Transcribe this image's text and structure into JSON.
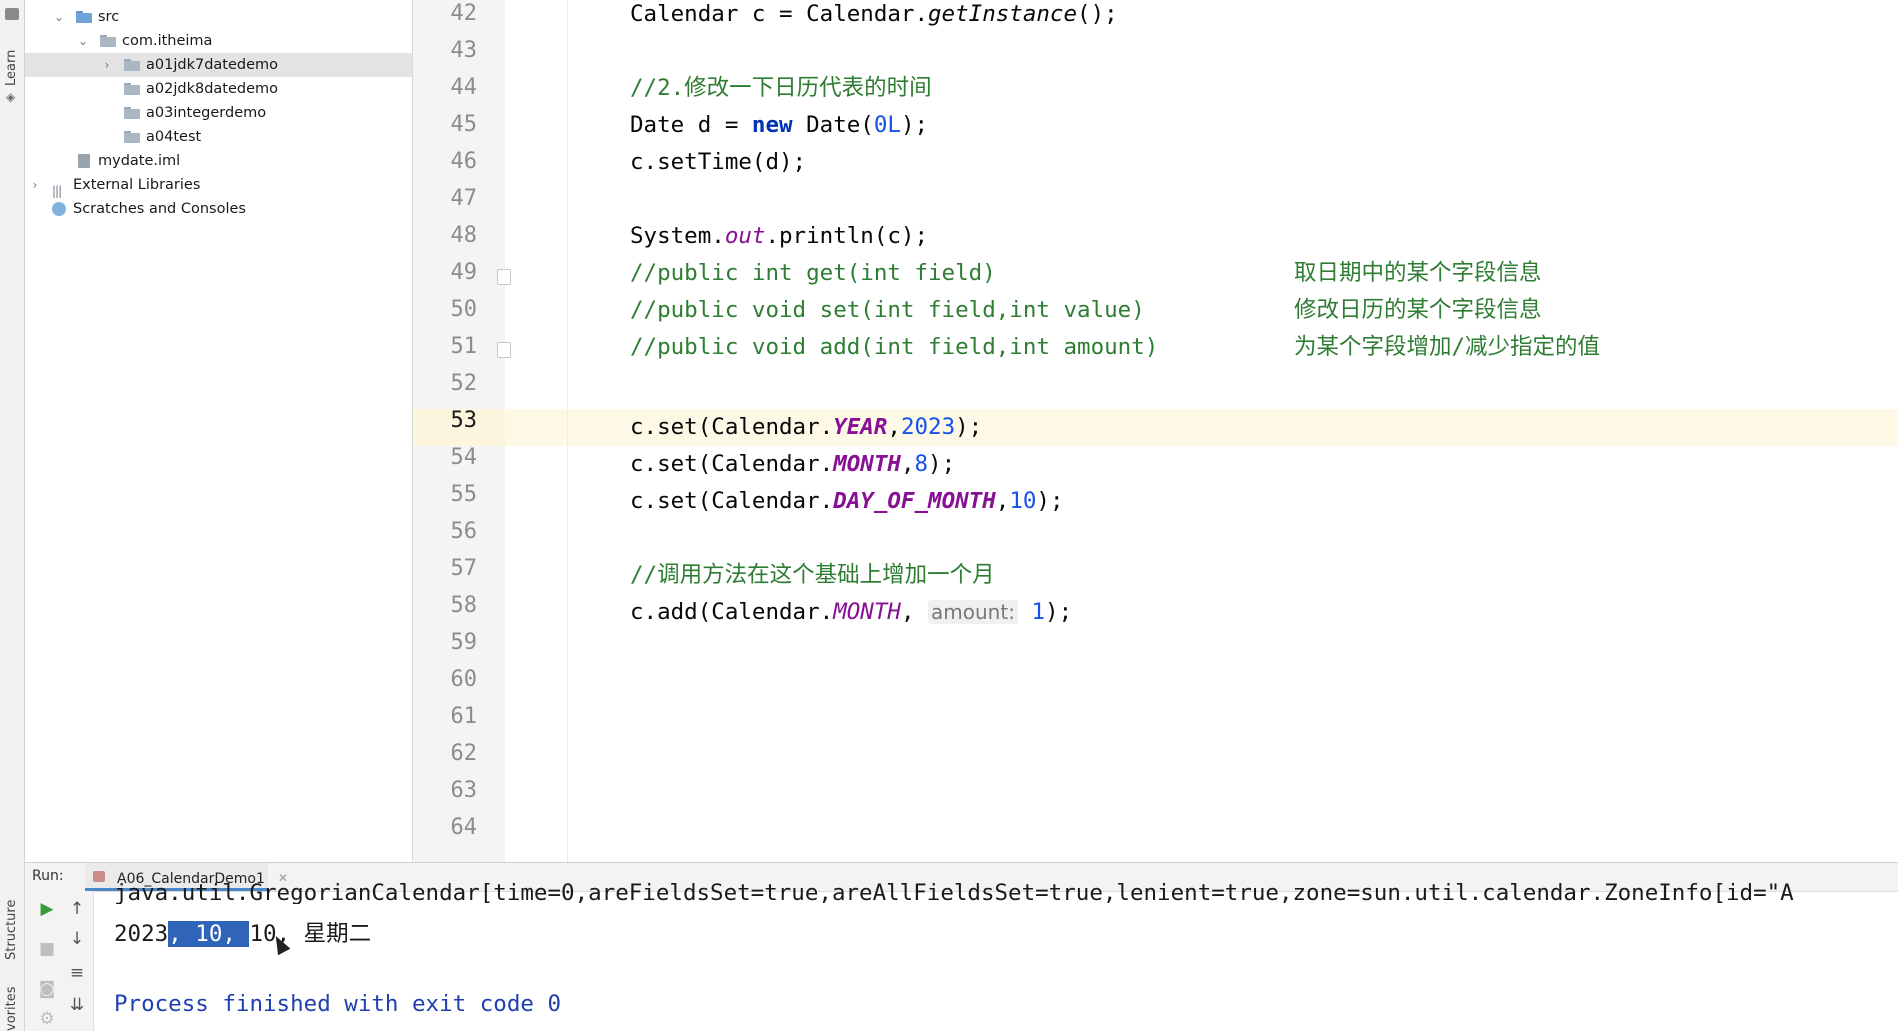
{
  "side_strip": {
    "learn_label": "Learn",
    "structure_label": "Structure",
    "favorites_label": "vorites"
  },
  "project_tree": {
    "src": "src",
    "package": "com.itheima",
    "folders": [
      "a01jdk7datedemo",
      "a02jdk8datedemo",
      "a03integerdemo",
      "a04test"
    ],
    "iml_file": "mydate.iml",
    "external_libraries": "External Libraries",
    "scratches": "Scratches and Consoles"
  },
  "editor": {
    "line_numbers": [
      "42",
      "43",
      "44",
      "45",
      "46",
      "47",
      "48",
      "49",
      "50",
      "51",
      "52",
      "53",
      "54",
      "55",
      "56",
      "57",
      "58",
      "59",
      "60",
      "61",
      "62",
      "63",
      "64"
    ],
    "current_line": "53",
    "line42": {
      "a": "Calendar c = Calendar.",
      "b": "getInstance",
      "c": "();"
    },
    "line44": "//2.修改一下日历代表的时间",
    "line45": {
      "a": "Date d = ",
      "kw": "new",
      "b": " Date(",
      "num": "0L",
      "c": ");"
    },
    "line46": "c.setTime(d);",
    "line48": {
      "a": "System.",
      "b": "out",
      "c": ".println(c);"
    },
    "line49": {
      "comment": "//public int get(int field)",
      "desc": "取日期中的某个字段信息"
    },
    "line50": {
      "comment": "//public void set(int field,int value)",
      "desc": "修改日历的某个字段信息"
    },
    "line51": {
      "comment": "//public void add(int field,int amount)",
      "desc": "为某个字段增加/减少指定的值"
    },
    "line53": {
      "a": "c.set(Calendar.",
      "f": "YEAR",
      "sep": ",",
      "num": "2023",
      "c": ");"
    },
    "line54": {
      "a": "c.set(Calendar.",
      "f": "MONTH",
      "sep": ",",
      "num": "8",
      "c": ");"
    },
    "line55": {
      "a": "c.set(Calendar.",
      "f": "DAY_OF_MONTH",
      "sep": ",",
      "num": "10",
      "c": ");"
    },
    "line57": "//调用方法在这个基础上增加一个月",
    "line58": {
      "a": "c.add(Calendar.",
      "f": "MONTH",
      "sep": ", ",
      "hint": "amount:",
      "num": "1",
      "c": ");"
    }
  },
  "run": {
    "label": "Run:",
    "tab": "A06_CalendarDemo1",
    "output_line1": "java.util.GregorianCalendar[time=0,areFieldsSet=true,areAllFieldsSet=true,lenient=true,zone=sun.util.calendar.ZoneInfo[id=\"A",
    "output_line2": {
      "a": "2023",
      "sel": ", 10, ",
      "b": "10, 星期二"
    },
    "finished": "Process finished with exit code 0"
  },
  "colors": {
    "keyword": "#0033b3",
    "number": "#1750eb",
    "field": "#871094",
    "comment": "#8c8c8c",
    "selection": "#2f64b8"
  }
}
